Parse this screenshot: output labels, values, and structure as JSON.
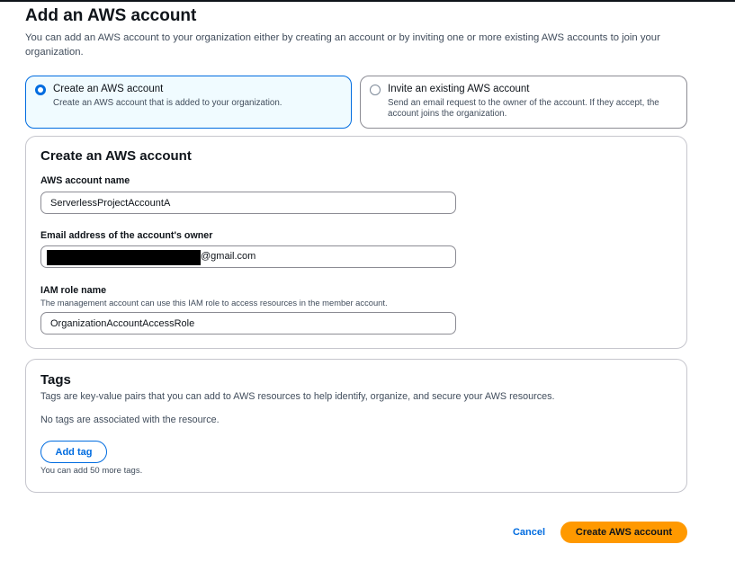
{
  "page": {
    "title": "Add an AWS account",
    "description": "You can add an AWS account to your organization either by creating an account or by inviting one or more existing AWS accounts to join your organization."
  },
  "options": [
    {
      "title": "Create an AWS account",
      "description": "Create an AWS account that is added to your organization.",
      "selected": true
    },
    {
      "title": "Invite an existing AWS account",
      "description": "Send an email request to the owner of the account. If they accept, the account joins the organization.",
      "selected": false
    }
  ],
  "create_panel": {
    "title": "Create an AWS account",
    "account_name": {
      "label": "AWS account name",
      "value": "ServerlessProjectAccountA"
    },
    "email": {
      "label": "Email address of the account's owner",
      "value_suffix": "@gmail.com"
    },
    "iam_role": {
      "label": "IAM role name",
      "description": "The management account can use this IAM role to access resources in the member account.",
      "value": "OrganizationAccountAccessRole"
    }
  },
  "tags_panel": {
    "title": "Tags",
    "description": "Tags are key-value pairs that you can add to AWS resources to help identify, organize, and secure your AWS resources.",
    "empty_text": "No tags are associated with the resource.",
    "add_button": "Add tag",
    "limit_text": "You can add 50 more tags."
  },
  "actions": {
    "cancel": "Cancel",
    "submit": "Create AWS account"
  },
  "colors": {
    "accent": "#006ce0",
    "selected_bg": "#f0fbff",
    "primary_button": "#ff9900",
    "text": "#0f141a",
    "secondary_text": "#414d5c",
    "border": "#c6c6cd"
  }
}
